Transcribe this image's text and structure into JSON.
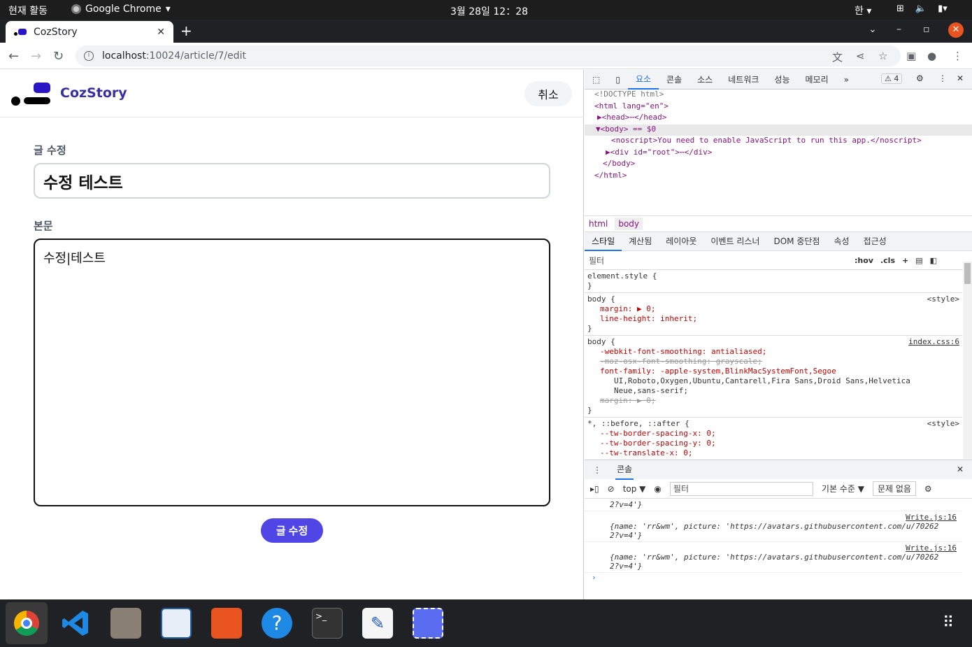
{
  "topbar": {
    "activities": "현재 활동",
    "app": "Google Chrome",
    "clock": "3월 28일  12：28",
    "ime": "한"
  },
  "browser": {
    "tab_title": "CozStory",
    "url_host": "localhost",
    "url_rest": ":10024/article/7/edit"
  },
  "app": {
    "brand": "CozStory",
    "cancel_label": "취소",
    "title_label": "글 수정",
    "title_value": "수정 테스트",
    "body_label": "본문",
    "body_value": "수정|테스트",
    "submit_label": "글 수정"
  },
  "devtools": {
    "tabs": [
      "요소",
      "콘솔",
      "소스",
      "네트워크",
      "성능",
      "메모리"
    ],
    "warn_count": "4",
    "elements": [
      "<!DOCTYPE html>",
      "<html lang=\"en\">",
      "▶<head>⋯</head>",
      "▼<body> == $0",
      "<noscript>You need to enable JavaScript to run this app.</noscript>",
      "▶<div id=\"root\">⋯</div>",
      "</body>",
      "</html>"
    ],
    "crumbs": [
      "html",
      "body"
    ],
    "style_tabs": [
      "스타일",
      "계산됨",
      "레이아웃",
      "이벤트 리스너",
      "DOM 중단점",
      "속성",
      "접근성"
    ],
    "filter_placeholder": "필터",
    "hov": ":hov",
    "cls": ".cls",
    "rules": {
      "r1_sel": "element.style {",
      "r2_sel": "body {",
      "r2_src": "<style>",
      "r2_p1": "margin: ▶ 0;",
      "r2_p2": "line-height: inherit;",
      "r3_sel": "body {",
      "r3_src": "index.css:6",
      "r3_p1": "-webkit-font-smoothing: antialiased;",
      "r3_p2": "-moz-osx-font-smoothing: grayscale;",
      "r3_p3": "font-family: -apple-system,BlinkMacSystemFont,Segoe",
      "r3_p4": "UI,Roboto,Oxygen,Ubuntu,Cantarell,Fira Sans,Droid Sans,Helvetica",
      "r3_p5": "Neue,sans-serif;",
      "r3_p6": "margin: ▶ 0;",
      "r4_sel": "*, ::before, ::after {",
      "r4_src": "<style>",
      "r4_p1": "--tw-border-spacing-x: 0;",
      "r4_p2": "--tw-border-spacing-y: 0;",
      "r4_p3": "--tw-translate-x: 0;",
      "close": "}"
    },
    "console": {
      "drawer_tab": "콘솔",
      "context": "top ▼",
      "filter": "필터",
      "level": "기본 수준 ▼",
      "issues": "문제 없음",
      "tail": "2?v=4'}",
      "loc": "Write.js:16",
      "obj1": "{name: 'rr&wm', picture: 'https://avatars.githubusercontent.com/u/70262",
      "obj2": "2?v=4'}"
    }
  }
}
